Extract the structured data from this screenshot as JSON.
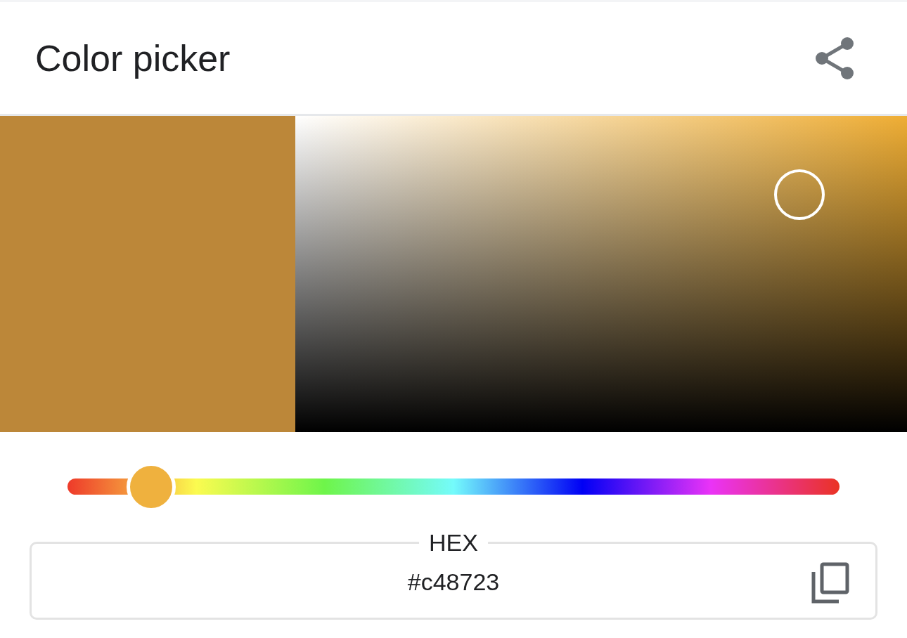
{
  "header": {
    "title": "Color picker"
  },
  "swatch": {
    "color": "#bc8739"
  },
  "hue_slider": {
    "level": 0.108
  },
  "hex_field": {
    "label": "HEX",
    "value": "#c48723"
  }
}
